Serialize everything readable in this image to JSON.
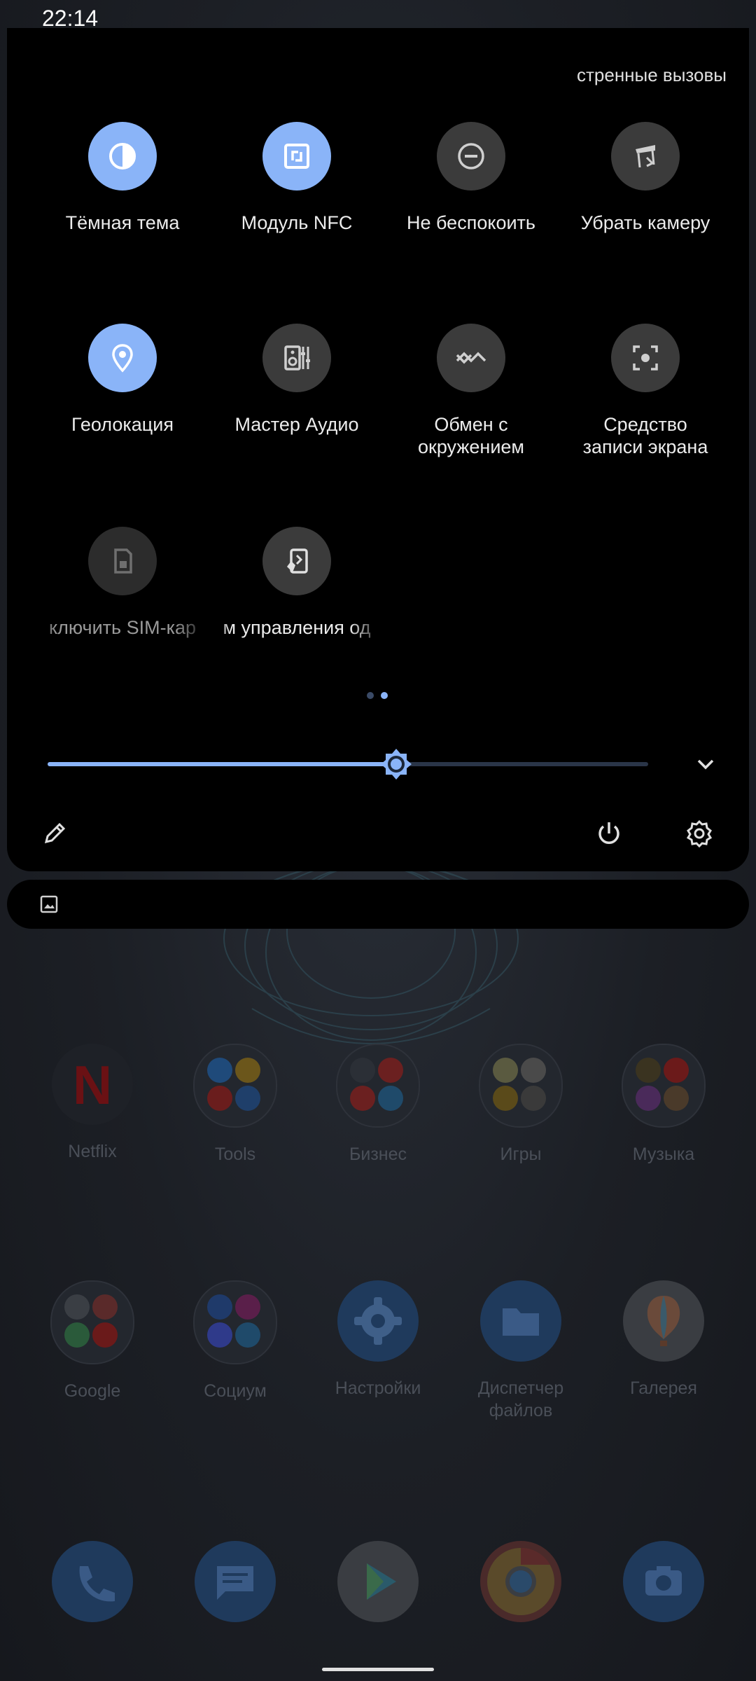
{
  "status_bar": {
    "time": "22:14"
  },
  "quick_settings": {
    "emergency_text": "стренные вызовы",
    "tiles": [
      {
        "label": "Тёмная тема",
        "icon": "dark-theme-icon",
        "state": "on"
      },
      {
        "label": "Модуль NFC",
        "icon": "nfc-icon",
        "state": "on"
      },
      {
        "label": "Не беспокоить",
        "icon": "do-not-disturb-icon",
        "state": "off"
      },
      {
        "label": "Убрать камеру",
        "icon": "retract-camera-icon",
        "state": "off"
      },
      {
        "label": "Геолокация",
        "icon": "location-icon",
        "state": "on"
      },
      {
        "label": "Мастер Аудио",
        "icon": "audio-wizard-icon",
        "state": "off"
      },
      {
        "label_line1": "Обмен с",
        "label_line2": "окружением",
        "icon": "nearby-share-icon",
        "state": "off"
      },
      {
        "label_line1": "Средство",
        "label_line2": "записи экрана",
        "icon": "screen-record-icon",
        "state": "off"
      },
      {
        "label": "ключить SIM-кар",
        "icon": "sim-card-icon",
        "state": "off"
      },
      {
        "label": "м управления од",
        "icon": "one-hand-mode-icon",
        "state": "off"
      }
    ],
    "page_indicator": {
      "pages": 2,
      "current": 2
    },
    "brightness": {
      "level": 0.58
    },
    "colors": {
      "accent": "#8ab4f8",
      "tile_off": "#3b3b3b",
      "panel": "#000000"
    }
  },
  "bottom_actions": {
    "edit": "pencil-icon",
    "power": "power-icon",
    "settings": "gear-icon",
    "expand": "chevron-down-icon"
  },
  "notification": {
    "icon": "image-icon"
  },
  "home_screen": {
    "row1": [
      {
        "label": "Netflix"
      },
      {
        "label": "Tools"
      },
      {
        "label": "Бизнес"
      },
      {
        "label": "Игры"
      },
      {
        "label": "Музыка"
      }
    ],
    "row2": [
      {
        "label": "Google"
      },
      {
        "label": "Социум"
      },
      {
        "label": "Настройки"
      },
      {
        "label_line1": "Диспетчер",
        "label_line2": "файлов"
      },
      {
        "label": "Галерея"
      }
    ],
    "dock": [
      "phone-icon",
      "messages-icon",
      "play-store-icon",
      "chrome-icon",
      "camera-icon"
    ]
  }
}
